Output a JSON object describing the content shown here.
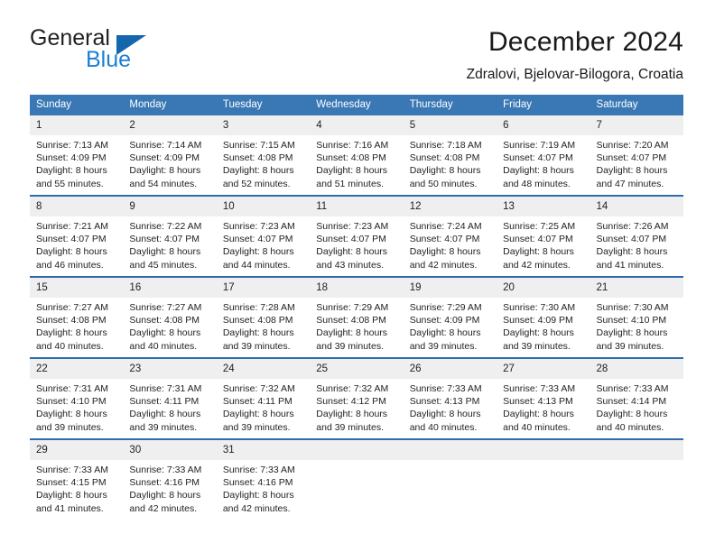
{
  "logo": {
    "word1": "General",
    "word2": "Blue",
    "triangle_color": "#1467ad",
    "word2_color": "#1a7fd4"
  },
  "header": {
    "title": "December 2024",
    "subtitle": "Zdralovi, Bjelovar-Bilogora, Croatia"
  },
  "theme": {
    "header_blue": "#3a78b5",
    "divider_blue": "#2f6cad",
    "daynum_bg": "#efefef"
  },
  "calendar": {
    "weekday_headers": [
      "Sunday",
      "Monday",
      "Tuesday",
      "Wednesday",
      "Thursday",
      "Friday",
      "Saturday"
    ],
    "weeks": [
      [
        {
          "day": "1",
          "sunrise": "Sunrise: 7:13 AM",
          "sunset": "Sunset: 4:09 PM",
          "daylight_l1": "Daylight: 8 hours",
          "daylight_l2": "and 55 minutes."
        },
        {
          "day": "2",
          "sunrise": "Sunrise: 7:14 AM",
          "sunset": "Sunset: 4:09 PM",
          "daylight_l1": "Daylight: 8 hours",
          "daylight_l2": "and 54 minutes."
        },
        {
          "day": "3",
          "sunrise": "Sunrise: 7:15 AM",
          "sunset": "Sunset: 4:08 PM",
          "daylight_l1": "Daylight: 8 hours",
          "daylight_l2": "and 52 minutes."
        },
        {
          "day": "4",
          "sunrise": "Sunrise: 7:16 AM",
          "sunset": "Sunset: 4:08 PM",
          "daylight_l1": "Daylight: 8 hours",
          "daylight_l2": "and 51 minutes."
        },
        {
          "day": "5",
          "sunrise": "Sunrise: 7:18 AM",
          "sunset": "Sunset: 4:08 PM",
          "daylight_l1": "Daylight: 8 hours",
          "daylight_l2": "and 50 minutes."
        },
        {
          "day": "6",
          "sunrise": "Sunrise: 7:19 AM",
          "sunset": "Sunset: 4:07 PM",
          "daylight_l1": "Daylight: 8 hours",
          "daylight_l2": "and 48 minutes."
        },
        {
          "day": "7",
          "sunrise": "Sunrise: 7:20 AM",
          "sunset": "Sunset: 4:07 PM",
          "daylight_l1": "Daylight: 8 hours",
          "daylight_l2": "and 47 minutes."
        }
      ],
      [
        {
          "day": "8",
          "sunrise": "Sunrise: 7:21 AM",
          "sunset": "Sunset: 4:07 PM",
          "daylight_l1": "Daylight: 8 hours",
          "daylight_l2": "and 46 minutes."
        },
        {
          "day": "9",
          "sunrise": "Sunrise: 7:22 AM",
          "sunset": "Sunset: 4:07 PM",
          "daylight_l1": "Daylight: 8 hours",
          "daylight_l2": "and 45 minutes."
        },
        {
          "day": "10",
          "sunrise": "Sunrise: 7:23 AM",
          "sunset": "Sunset: 4:07 PM",
          "daylight_l1": "Daylight: 8 hours",
          "daylight_l2": "and 44 minutes."
        },
        {
          "day": "11",
          "sunrise": "Sunrise: 7:23 AM",
          "sunset": "Sunset: 4:07 PM",
          "daylight_l1": "Daylight: 8 hours",
          "daylight_l2": "and 43 minutes."
        },
        {
          "day": "12",
          "sunrise": "Sunrise: 7:24 AM",
          "sunset": "Sunset: 4:07 PM",
          "daylight_l1": "Daylight: 8 hours",
          "daylight_l2": "and 42 minutes."
        },
        {
          "day": "13",
          "sunrise": "Sunrise: 7:25 AM",
          "sunset": "Sunset: 4:07 PM",
          "daylight_l1": "Daylight: 8 hours",
          "daylight_l2": "and 42 minutes."
        },
        {
          "day": "14",
          "sunrise": "Sunrise: 7:26 AM",
          "sunset": "Sunset: 4:07 PM",
          "daylight_l1": "Daylight: 8 hours",
          "daylight_l2": "and 41 minutes."
        }
      ],
      [
        {
          "day": "15",
          "sunrise": "Sunrise: 7:27 AM",
          "sunset": "Sunset: 4:08 PM",
          "daylight_l1": "Daylight: 8 hours",
          "daylight_l2": "and 40 minutes."
        },
        {
          "day": "16",
          "sunrise": "Sunrise: 7:27 AM",
          "sunset": "Sunset: 4:08 PM",
          "daylight_l1": "Daylight: 8 hours",
          "daylight_l2": "and 40 minutes."
        },
        {
          "day": "17",
          "sunrise": "Sunrise: 7:28 AM",
          "sunset": "Sunset: 4:08 PM",
          "daylight_l1": "Daylight: 8 hours",
          "daylight_l2": "and 39 minutes."
        },
        {
          "day": "18",
          "sunrise": "Sunrise: 7:29 AM",
          "sunset": "Sunset: 4:08 PM",
          "daylight_l1": "Daylight: 8 hours",
          "daylight_l2": "and 39 minutes."
        },
        {
          "day": "19",
          "sunrise": "Sunrise: 7:29 AM",
          "sunset": "Sunset: 4:09 PM",
          "daylight_l1": "Daylight: 8 hours",
          "daylight_l2": "and 39 minutes."
        },
        {
          "day": "20",
          "sunrise": "Sunrise: 7:30 AM",
          "sunset": "Sunset: 4:09 PM",
          "daylight_l1": "Daylight: 8 hours",
          "daylight_l2": "and 39 minutes."
        },
        {
          "day": "21",
          "sunrise": "Sunrise: 7:30 AM",
          "sunset": "Sunset: 4:10 PM",
          "daylight_l1": "Daylight: 8 hours",
          "daylight_l2": "and 39 minutes."
        }
      ],
      [
        {
          "day": "22",
          "sunrise": "Sunrise: 7:31 AM",
          "sunset": "Sunset: 4:10 PM",
          "daylight_l1": "Daylight: 8 hours",
          "daylight_l2": "and 39 minutes."
        },
        {
          "day": "23",
          "sunrise": "Sunrise: 7:31 AM",
          "sunset": "Sunset: 4:11 PM",
          "daylight_l1": "Daylight: 8 hours",
          "daylight_l2": "and 39 minutes."
        },
        {
          "day": "24",
          "sunrise": "Sunrise: 7:32 AM",
          "sunset": "Sunset: 4:11 PM",
          "daylight_l1": "Daylight: 8 hours",
          "daylight_l2": "and 39 minutes."
        },
        {
          "day": "25",
          "sunrise": "Sunrise: 7:32 AM",
          "sunset": "Sunset: 4:12 PM",
          "daylight_l1": "Daylight: 8 hours",
          "daylight_l2": "and 39 minutes."
        },
        {
          "day": "26",
          "sunrise": "Sunrise: 7:33 AM",
          "sunset": "Sunset: 4:13 PM",
          "daylight_l1": "Daylight: 8 hours",
          "daylight_l2": "and 40 minutes."
        },
        {
          "day": "27",
          "sunrise": "Sunrise: 7:33 AM",
          "sunset": "Sunset: 4:13 PM",
          "daylight_l1": "Daylight: 8 hours",
          "daylight_l2": "and 40 minutes."
        },
        {
          "day": "28",
          "sunrise": "Sunrise: 7:33 AM",
          "sunset": "Sunset: 4:14 PM",
          "daylight_l1": "Daylight: 8 hours",
          "daylight_l2": "and 40 minutes."
        }
      ],
      [
        {
          "day": "29",
          "sunrise": "Sunrise: 7:33 AM",
          "sunset": "Sunset: 4:15 PM",
          "daylight_l1": "Daylight: 8 hours",
          "daylight_l2": "and 41 minutes."
        },
        {
          "day": "30",
          "sunrise": "Sunrise: 7:33 AM",
          "sunset": "Sunset: 4:16 PM",
          "daylight_l1": "Daylight: 8 hours",
          "daylight_l2": "and 42 minutes."
        },
        {
          "day": "31",
          "sunrise": "Sunrise: 7:33 AM",
          "sunset": "Sunset: 4:16 PM",
          "daylight_l1": "Daylight: 8 hours",
          "daylight_l2": "and 42 minutes."
        },
        {
          "day": "",
          "sunrise": "",
          "sunset": "",
          "daylight_l1": "",
          "daylight_l2": ""
        },
        {
          "day": "",
          "sunrise": "",
          "sunset": "",
          "daylight_l1": "",
          "daylight_l2": ""
        },
        {
          "day": "",
          "sunrise": "",
          "sunset": "",
          "daylight_l1": "",
          "daylight_l2": ""
        },
        {
          "day": "",
          "sunrise": "",
          "sunset": "",
          "daylight_l1": "",
          "daylight_l2": ""
        }
      ]
    ]
  }
}
